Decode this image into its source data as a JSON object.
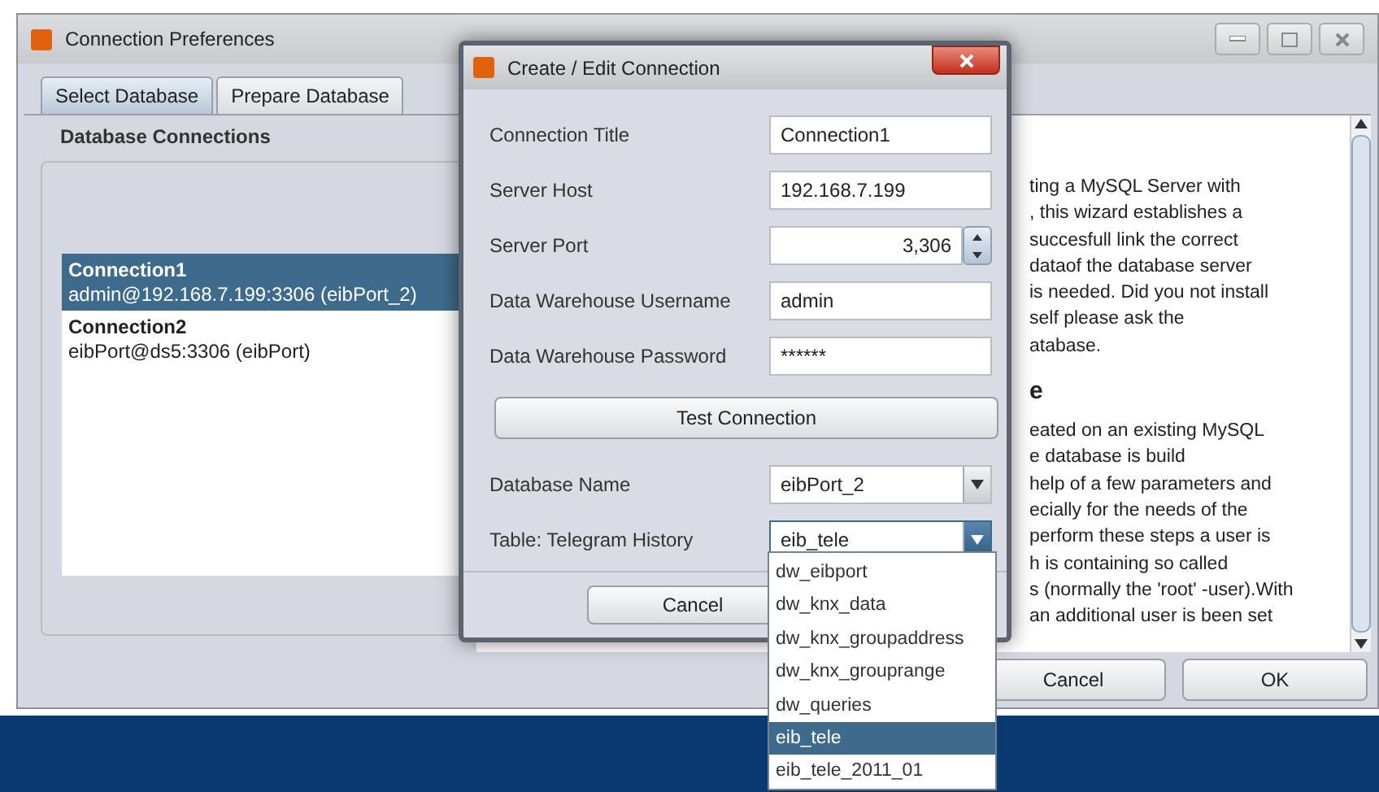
{
  "main_window": {
    "title": "Connection Preferences",
    "tabs": [
      {
        "label": "Select Database",
        "selected": true
      },
      {
        "label": "Prepare Database",
        "selected": false
      }
    ],
    "section_label": "Database Connections",
    "connections": [
      {
        "title": "Connection1",
        "detail": "admin@192.168.7.199:3306 (eibPort_2)",
        "selected": true
      },
      {
        "title": "Connection2",
        "detail": "eibPort@ds5:3306 (eibPort)",
        "selected": false
      }
    ],
    "help_lines": [
      {
        "kind": "text",
        "text": "ting a MySQL Server with"
      },
      {
        "kind": "text",
        "text": ", this wizard establishes a"
      },
      {
        "kind": "text",
        "text": "succesfull link the correct"
      },
      {
        "kind": "text",
        "text": "dataof the database server"
      },
      {
        "kind": "text",
        "text": "is needed. Did you not install"
      },
      {
        "kind": "text",
        "text": "self please ask the"
      },
      {
        "kind": "text",
        "text": "atabase."
      },
      {
        "kind": "heading",
        "text": "e"
      },
      {
        "kind": "text",
        "text": "eated on an existing MySQL"
      },
      {
        "kind": "text",
        "text": "e database is build"
      },
      {
        "kind": "text",
        "text": "help of a few parameters and"
      },
      {
        "kind": "text",
        "text": "ecially for the needs of the"
      },
      {
        "kind": "text",
        "text": "perform these steps a user is"
      },
      {
        "kind": "text",
        "text": "h is containing so called"
      },
      {
        "kind": "text",
        "text": "s (normally the 'root' -user).With"
      },
      {
        "kind": "text",
        "text": "an additional user is been set"
      }
    ],
    "buttons": [
      "Cancel",
      "OK"
    ]
  },
  "dialog": {
    "title": "Create / Edit Connection",
    "fields": [
      {
        "kind": "text",
        "label": "Connection Title",
        "value": "Connection1"
      },
      {
        "kind": "text",
        "label": "Server Host",
        "value": "192.168.7.199"
      },
      {
        "kind": "spinner",
        "label": "Server Port",
        "value": "3,306"
      },
      {
        "kind": "text",
        "label": "Data Warehouse Username",
        "value": "admin"
      },
      {
        "kind": "text",
        "label": "Data Warehouse Password",
        "value": "******"
      }
    ],
    "test_button": "Test Connection",
    "combos": [
      {
        "label": "Database Name",
        "value": "eibPort_2",
        "open": false
      },
      {
        "label": "Table: Telegram History",
        "value": "eib_tele",
        "open": true
      }
    ],
    "buttons": [
      "Cancel"
    ]
  },
  "dropdown": {
    "items": [
      {
        "label": "dw_eibport",
        "selected": false
      },
      {
        "label": "dw_knx_data",
        "selected": false
      },
      {
        "label": "dw_knx_groupaddress",
        "selected": false
      },
      {
        "label": "dw_knx_grouprange",
        "selected": false
      },
      {
        "label": "dw_queries",
        "selected": false
      },
      {
        "label": "eib_tele",
        "selected": true
      },
      {
        "label": "eib_tele_2011_01",
        "selected": false
      }
    ]
  }
}
